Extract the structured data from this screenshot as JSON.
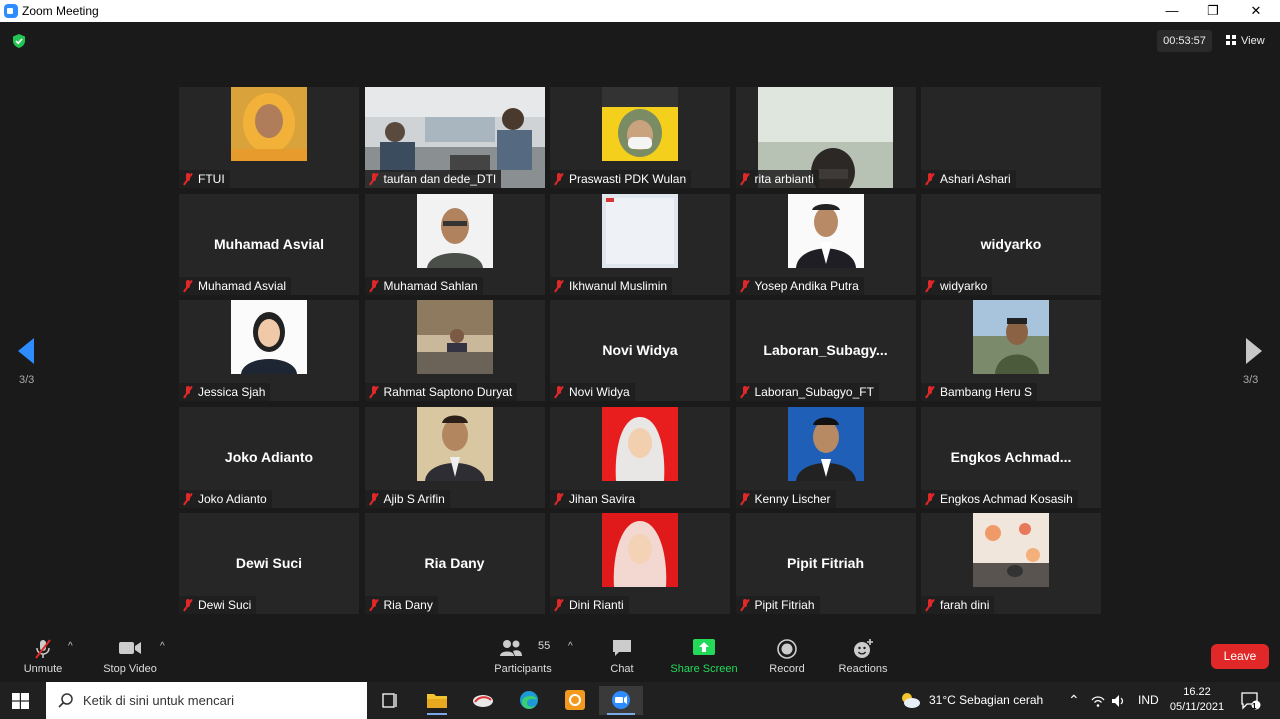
{
  "window": {
    "title": "Zoom Meeting",
    "minimize": "—",
    "restore": "❐",
    "close": "✕"
  },
  "header": {
    "timer": "00:53:57",
    "view_label": "View"
  },
  "pagination": {
    "left": "3/3",
    "right": "3/3"
  },
  "participants": [
    {
      "tile_name": "",
      "label": "FTUI",
      "photo": "yellow-hijab"
    },
    {
      "tile_name": "",
      "label": "taufan dan dede_DTI",
      "photo": "office-wide"
    },
    {
      "tile_name": "",
      "label": "Praswasti PDK Wulan",
      "photo": "mask-yellow"
    },
    {
      "tile_name": "",
      "label": "rita arbianti",
      "photo": "window-cam"
    },
    {
      "tile_name": "",
      "label": "Ashari Ashari",
      "photo": ""
    },
    {
      "tile_name": "Muhamad Asvial",
      "label": "Muhamad Asvial",
      "photo": ""
    },
    {
      "tile_name": "",
      "label": "Muhamad Sahlan",
      "photo": "man-glasses"
    },
    {
      "tile_name": "",
      "label": "Ikhwanul Muslimin",
      "photo": "slide"
    },
    {
      "tile_name": "",
      "label": "Yosep Andika Putra",
      "photo": "man-suit-white"
    },
    {
      "tile_name": "widyarko",
      "label": "widyarko",
      "photo": ""
    },
    {
      "tile_name": "",
      "label": "Jessica Sjah",
      "photo": "woman-white"
    },
    {
      "tile_name": "",
      "label": "Rahmat Saptono Duryat",
      "photo": "room-desk"
    },
    {
      "tile_name": "Novi Widya",
      "label": "Novi Widya",
      "photo": ""
    },
    {
      "tile_name": "Laboran_Subagy...",
      "label": "Laboran_Subagyo_FT",
      "photo": ""
    },
    {
      "tile_name": "",
      "label": "Bambang Heru S",
      "photo": "man-outdoor"
    },
    {
      "tile_name": "Joko Adianto",
      "label": "Joko Adianto",
      "photo": ""
    },
    {
      "tile_name": "",
      "label": "Ajib S Arifin",
      "photo": "man-suit-light"
    },
    {
      "tile_name": "",
      "label": "Jihan Savira",
      "photo": "hijab-red"
    },
    {
      "tile_name": "",
      "label": "Kenny Lischer",
      "photo": "man-blue"
    },
    {
      "tile_name": "Engkos  Achmad...",
      "label": "Engkos Achmad Kosasih",
      "photo": ""
    },
    {
      "tile_name": "Dewi Suci",
      "label": "Dewi Suci",
      "photo": ""
    },
    {
      "tile_name": "Ria Dany",
      "label": "Ria Dany",
      "photo": ""
    },
    {
      "tile_name": "",
      "label": "Dini Rianti",
      "photo": "hijab-red2"
    },
    {
      "tile_name": "Pipit Fitriah",
      "label": "Pipit Fitriah",
      "photo": ""
    },
    {
      "tile_name": "",
      "label": "farah dini",
      "photo": "mural"
    }
  ],
  "toolbar": {
    "unmute": "Unmute",
    "stop_video": "Stop Video",
    "participants": "Participants",
    "participants_count": "55",
    "chat": "Chat",
    "share_screen": "Share Screen",
    "record": "Record",
    "reactions": "Reactions",
    "leave": "Leave"
  },
  "taskbar": {
    "search_placeholder": "Ketik di sini untuk mencari",
    "weather": "31°C  Sebagian cerah",
    "language": "IND",
    "time": "16.22",
    "date": "05/11/2021",
    "notification_count": "1"
  },
  "colors": {
    "accent": "#2d8cff",
    "share": "#23d959",
    "leave": "#e02828",
    "muted": "#e02828"
  }
}
